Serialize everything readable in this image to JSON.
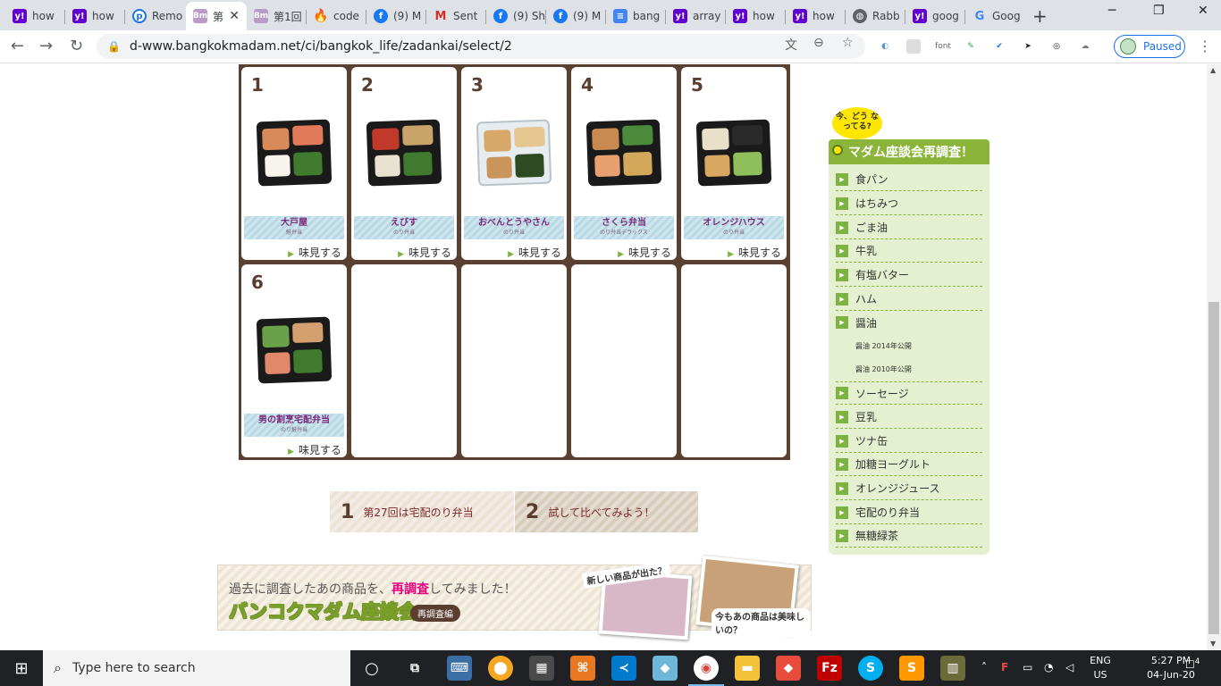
{
  "browser": {
    "tabs": [
      {
        "label": "how",
        "icon": "yahoo-icon",
        "active": false
      },
      {
        "label": "how",
        "icon": "yahoo-icon",
        "active": false
      },
      {
        "label": "Remo",
        "icon": "remo-icon",
        "active": false
      },
      {
        "label": "第",
        "icon": "bm-icon",
        "active": true
      },
      {
        "label": "第1回",
        "icon": "bm-icon",
        "active": false
      },
      {
        "label": "code",
        "icon": "fire-icon",
        "active": false
      },
      {
        "label": "(9) M",
        "icon": "facebook-icon",
        "active": false
      },
      {
        "label": "Sent",
        "icon": "gmail-icon",
        "active": false
      },
      {
        "label": "(9) Sh",
        "icon": "facebook-icon",
        "active": false
      },
      {
        "label": "(9) M",
        "icon": "facebook-icon",
        "active": false
      },
      {
        "label": "bang",
        "icon": "docs-icon",
        "active": false
      },
      {
        "label": "array",
        "icon": "yahoo-icon",
        "active": false
      },
      {
        "label": "how",
        "icon": "yahoo-icon",
        "active": false
      },
      {
        "label": "how",
        "icon": "yahoo-icon",
        "active": false
      },
      {
        "label": "Rabb",
        "icon": "globe-icon",
        "active": false
      },
      {
        "label": "goog",
        "icon": "yahoo-icon",
        "active": false
      },
      {
        "label": "Goog",
        "icon": "google-icon",
        "active": false
      }
    ],
    "url": "d-www.bangkokmadam.net/ci/bangkok_life/zadankai/select/2",
    "ext_font_label": "font",
    "profile_status": "Paused"
  },
  "grid": {
    "taste_label": "味見する",
    "items": [
      {
        "num": "1",
        "name": "大戸屋",
        "sub": "鮭弁当"
      },
      {
        "num": "2",
        "name": "えびす",
        "sub": "のり弁当"
      },
      {
        "num": "3",
        "name": "おべんとうやさん",
        "sub": "のり弁当"
      },
      {
        "num": "4",
        "name": "さくら弁当",
        "sub": "のり弁当デラックス"
      },
      {
        "num": "5",
        "name": "オレンジハウス",
        "sub": "のり弁当"
      },
      {
        "num": "6",
        "name": "男の割烹宅配弁当",
        "sub": "のり鮭弁当"
      }
    ]
  },
  "pager": [
    {
      "num": "1",
      "label": "第27回は宅配のり弁当"
    },
    {
      "num": "2",
      "label": "試して比べてみよう！"
    }
  ],
  "banner": {
    "line1_pre": "過去に調査したあの商品を、",
    "line1_hl": "再調査",
    "line1_post": "してみました！",
    "title": "バンコクマダム座談会",
    "badge": "再調査編",
    "caption1": "新しい商品が出た？",
    "caption2": "今もあの商品は美味しいの？"
  },
  "sidebar": {
    "bubble": "今、どう なってる?",
    "heading": "マダム座談会再調査！",
    "items": [
      {
        "label": "食パン"
      },
      {
        "label": "はちみつ"
      },
      {
        "label": "ごま油"
      },
      {
        "label": "牛乳"
      },
      {
        "label": "有塩バター"
      },
      {
        "label": "ハム"
      },
      {
        "label": "醤油"
      }
    ],
    "subitems": [
      "醤油 2014年公開",
      "醤油 2010年公開"
    ],
    "items2": [
      {
        "label": "ソーセージ"
      },
      {
        "label": "豆乳"
      },
      {
        "label": "ツナ缶"
      },
      {
        "label": "加糖ヨーグルト"
      },
      {
        "label": "オレンジジュース"
      },
      {
        "label": "宅配のり弁当"
      },
      {
        "label": "無糖緑茶"
      }
    ]
  },
  "taskbar": {
    "search_placeholder": "Type here to search",
    "lang_top": "ENG",
    "lang_bottom": "US",
    "time": "5:27 PM",
    "date": "04-Jun-20",
    "notifications": "4"
  }
}
